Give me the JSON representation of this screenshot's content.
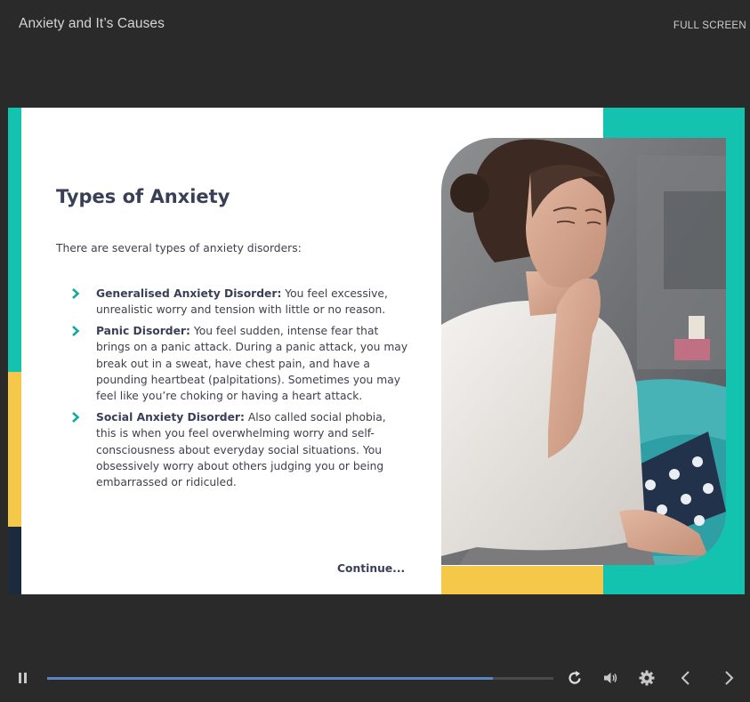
{
  "window": {
    "title": "Anxiety and It’s Causes",
    "fullscreen_label": "FULL SCREEN"
  },
  "slide": {
    "heading": "Types of Anxiety",
    "intro": "There are several types of anxiety disorders:",
    "items": [
      {
        "term": "Generalised Anxiety Disorder:",
        "text": " You feel excessive, unrealistic worry and tension with little or no reason."
      },
      {
        "term": "Panic Disorder:",
        "text": " You feel sudden, intense fear that brings on a panic attack. During a panic attack, you may break out in a sweat, have chest pain, and have a pounding heartbeat (palpitations). Sometimes you may feel like you’re choking or having a heart attack."
      },
      {
        "term": "Social Anxiety Disorder:",
        "text": " Also called social phobia, this is when you feel overwhelming worry and self-consciousness about everyday social situations. You obsessively worry about others judging you or being embarrassed or ridiculed."
      }
    ],
    "continue_label": "Continue..."
  },
  "player": {
    "progress": 0.88,
    "icons": {
      "pause": "pause-icon",
      "replay": "replay-icon",
      "volume": "volume-icon",
      "settings": "gear-icon",
      "prev": "chevron-left-icon",
      "next": "chevron-right-icon"
    }
  },
  "colors": {
    "background": "#2a2a2a",
    "teal": "#13c3b0",
    "yellow": "#f5c84a",
    "navy": "#1c2a3e",
    "heading": "#3a3f58",
    "progress": "#5b84c4",
    "chevron": "#14a8a0"
  }
}
